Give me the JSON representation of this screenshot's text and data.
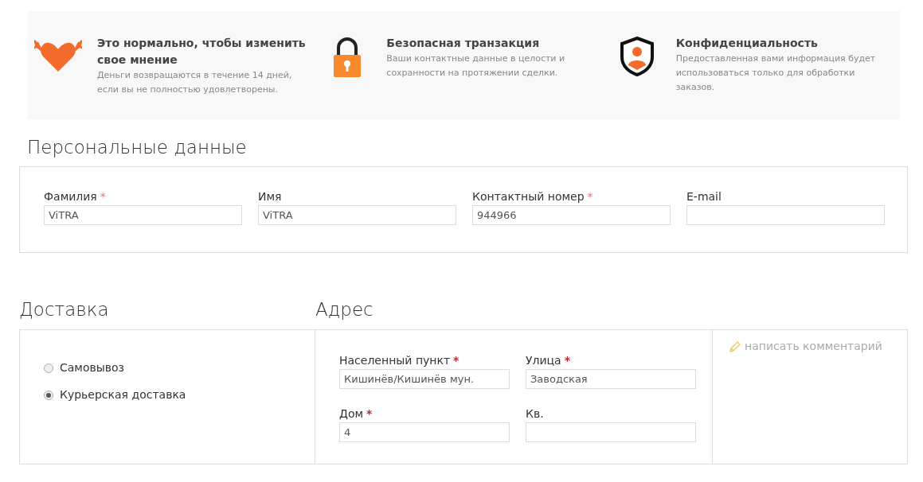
{
  "features": [
    {
      "kind": "heart",
      "title": "Это нормально, чтобы изменить свое мнение",
      "text": "Деньги возвращаются в течение 14 дней, если вы не полностью удовлетворены."
    },
    {
      "kind": "lock",
      "title": "Безопасная транзакция",
      "text": "Ваши контактные данные в целости и сохранности на протяжении сделки."
    },
    {
      "kind": "shield",
      "title": "Конфиденциальность",
      "text": "Предоставленная вами информация будет использоваться только для обработки заказов."
    }
  ],
  "personal": {
    "title": "Персональные данные",
    "fields": [
      {
        "label": "Фамилия",
        "required_mark": "*",
        "value": "ViTRA"
      },
      {
        "label": "Имя",
        "value": "ViTRA"
      },
      {
        "label": "Контактный номер",
        "required_mark": "*",
        "value": "944966"
      },
      {
        "label": "E-mail"
      }
    ]
  },
  "delivery": {
    "title": "Доставка",
    "options": [
      {
        "label": "Самовывоз",
        "selected": false
      },
      {
        "label": "Курьерская доставка",
        "selected": true
      }
    ]
  },
  "address": {
    "title": "Адрес",
    "fields": [
      {
        "label": "Населенный пункт",
        "required_mark": "*",
        "value": "Кишинёв/Кишинёв мун."
      },
      {
        "label": "Улица",
        "required_mark": "*",
        "value": "Заводская"
      },
      {
        "label": "Дом",
        "required_mark": "*",
        "value": "4"
      },
      {
        "label": "Кв."
      }
    ],
    "comment_link": "написать комментарий"
  }
}
